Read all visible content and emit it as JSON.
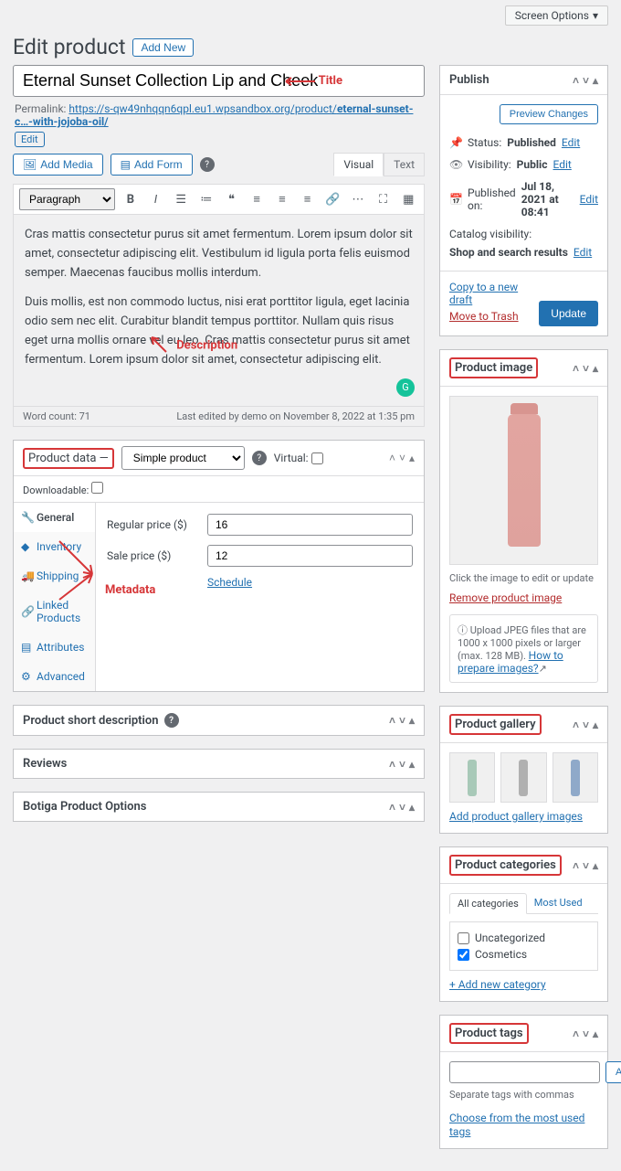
{
  "screen_options": "Screen Options",
  "page_title": "Edit product",
  "add_new": "Add New",
  "title_value": "Eternal Sunset Collection Lip and Cheek",
  "annotation_title": "Title",
  "annotation_desc": "Description",
  "annotation_meta": "Metadata",
  "permalink": {
    "label": "Permalink:",
    "url_prefix": "https://s-qw49nhqqn6qpl.eu1.wpsandbox.org/product/",
    "slug": "eternal-sunset-c…-with-jojoba-oil/",
    "edit": "Edit"
  },
  "media": {
    "add_media": "Add Media",
    "add_form": "Add Form"
  },
  "editor_tabs": {
    "visual": "Visual",
    "text": "Text"
  },
  "format_dropdown": "Paragraph",
  "content_p1": "Cras mattis consectetur purus sit amet fermentum. Lorem ipsum dolor sit amet, consectetur adipiscing elit. Vestibulum id ligula porta felis euismod semper. Maecenas faucibus mollis interdum.",
  "content_p2": "Duis mollis, est non commodo luctus, nisi erat porttitor ligula, eget lacinia odio sem nec elit. Curabitur blandit tempus porttitor. Nullam quis risus eget urna mollis ornare vel eu leo. Cras mattis consectetur purus sit amet fermentum. Lorem ipsum dolor sit amet, consectetur adipiscing elit.",
  "word_count": "Word count: 71",
  "last_edited": "Last edited by demo on November 8, 2022 at 1:35 pm",
  "product_data": {
    "title": "Product data —",
    "type": "Simple product",
    "virtual": "Virtual:",
    "downloadable": "Downloadable:",
    "tabs": [
      "General",
      "Inventory",
      "Shipping",
      "Linked Products",
      "Attributes",
      "Advanced"
    ],
    "regular_price_label": "Regular price ($)",
    "regular_price": "16",
    "sale_price_label": "Sale price ($)",
    "sale_price": "12",
    "schedule": "Schedule"
  },
  "short_desc_title": "Product short description",
  "reviews_title": "Reviews",
  "botiga_title": "Botiga Product Options",
  "publish": {
    "title": "Publish",
    "preview": "Preview Changes",
    "status_label": "Status:",
    "status": "Published",
    "visibility_label": "Visibility:",
    "visibility": "Public",
    "published_on_label": "Published on:",
    "published_on": "Jul 18, 2021 at 08:41",
    "catalog_label": "Catalog visibility:",
    "catalog": "Shop and search results",
    "edit": "Edit",
    "copy": "Copy to a new draft",
    "trash": "Move to Trash",
    "update": "Update"
  },
  "product_image": {
    "title": "Product image",
    "hint": "Click the image to edit or update",
    "remove": "Remove product image",
    "upload_hint": "Upload JPEG files that are 1000 x 1000 pixels or larger (max. 128 MB). ",
    "how_to": "How to prepare images?"
  },
  "gallery": {
    "title": "Product gallery",
    "add": "Add product gallery images"
  },
  "categories": {
    "title": "Product categories",
    "tab_all": "All categories",
    "tab_most": "Most Used",
    "items": [
      {
        "label": "Uncategorized",
        "checked": false
      },
      {
        "label": "Cosmetics",
        "checked": true
      }
    ],
    "add_new": "+ Add new category"
  },
  "tags": {
    "title": "Product tags",
    "add": "Add",
    "hint": "Separate tags with commas",
    "choose": "Choose from the most used tags"
  }
}
